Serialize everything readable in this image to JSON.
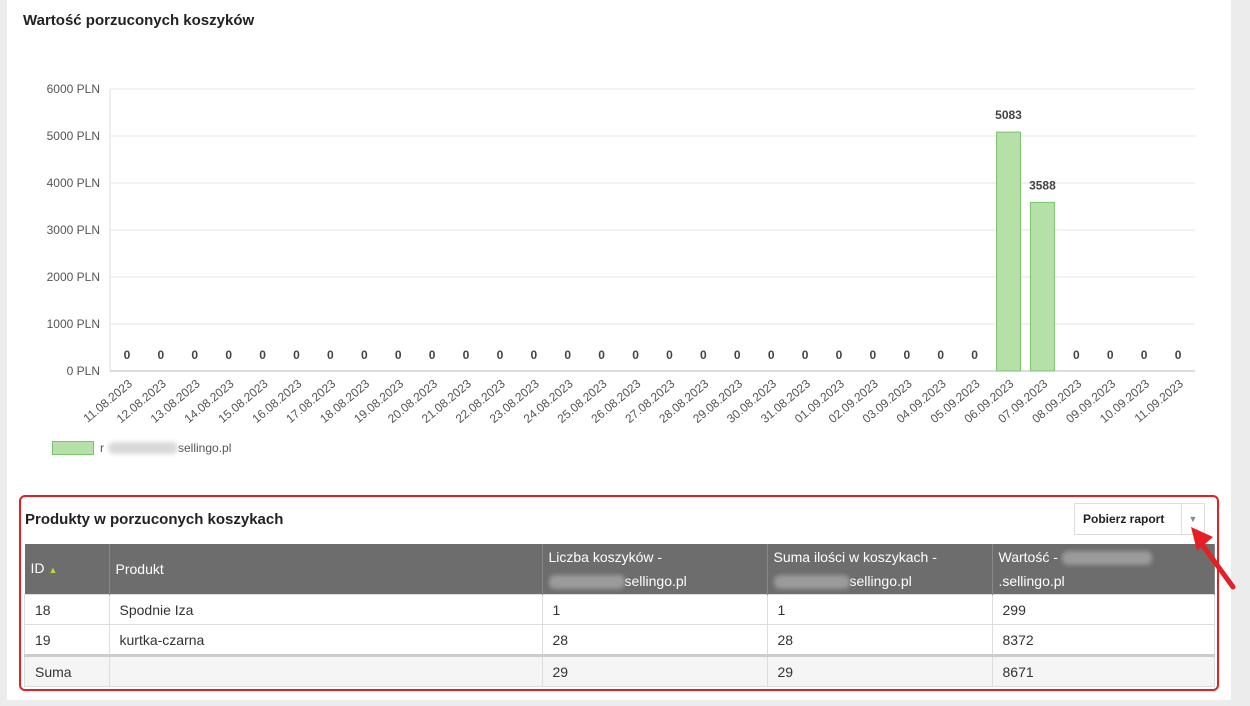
{
  "chart_section": {
    "title": "Wartość porzuconych koszyków",
    "legend_label": "r           sellingo.pl",
    "legend_label_visible": "sellingo.pl"
  },
  "chart_data": {
    "type": "bar",
    "title": "Wartość porzuconych koszyków",
    "categories": [
      "11.08.2023",
      "12.08.2023",
      "13.08.2023",
      "14.08.2023",
      "15.08.2023",
      "16.08.2023",
      "17.08.2023",
      "18.08.2023",
      "19.08.2023",
      "20.08.2023",
      "21.08.2023",
      "22.08.2023",
      "23.08.2023",
      "24.08.2023",
      "25.08.2023",
      "26.08.2023",
      "27.08.2023",
      "28.08.2023",
      "29.08.2023",
      "30.08.2023",
      "31.08.2023",
      "01.09.2023",
      "02.09.2023",
      "03.09.2023",
      "04.09.2023",
      "05.09.2023",
      "06.09.2023",
      "07.09.2023",
      "08.09.2023",
      "09.09.2023",
      "10.09.2023",
      "11.09.2023"
    ],
    "series": [
      {
        "name": "r           sellingo.pl",
        "values": [
          0,
          0,
          0,
          0,
          0,
          0,
          0,
          0,
          0,
          0,
          0,
          0,
          0,
          0,
          0,
          0,
          0,
          0,
          0,
          0,
          0,
          0,
          0,
          0,
          0,
          0,
          5083,
          3588,
          0,
          0,
          0,
          0
        ]
      }
    ],
    "y_ticks": [
      "0 PLN",
      "1000 PLN",
      "2000 PLN",
      "3000 PLN",
      "4000 PLN",
      "5000 PLN",
      "6000 PLN"
    ],
    "ylim": [
      0,
      6000
    ],
    "grid": true,
    "legend_position": "bottom-left",
    "colors": {
      "bar_fill": "#b5e0a7",
      "bar_stroke": "#7cc36d"
    }
  },
  "products": {
    "title": "Produkty w porzuconych koszykach",
    "download_label": "Pobierz raport",
    "columns": {
      "id": "ID",
      "product": "Produkt",
      "cart_count_line1": "Liczba koszyków -",
      "cart_count_line2": "sellingo.pl",
      "qty_sum_line1": "Suma ilości w koszykach -",
      "qty_sum_line2": "sellingo.pl",
      "value_prefix": "Wartość -",
      "value_suffix": ".sellingo.pl"
    },
    "rows": [
      {
        "id": "18",
        "product": "Spodnie Iza",
        "carts": "1",
        "qty": "1",
        "value": "299"
      },
      {
        "id": "19",
        "product": "kurtka-czarna",
        "carts": "28",
        "qty": "28",
        "value": "8372"
      }
    ],
    "sum": {
      "label": "Suma",
      "product": "",
      "carts": "29",
      "qty": "29",
      "value": "8671"
    }
  },
  "colors": {
    "highlight_border": "#e41f26",
    "header_bg": "#6d6d6d",
    "sort_arrow": "#c8d62d"
  }
}
